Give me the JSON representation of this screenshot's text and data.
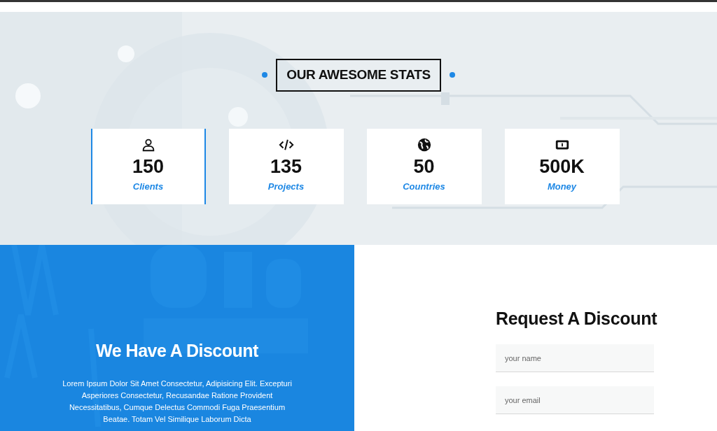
{
  "stats_section": {
    "title": "OUR AWESOME STATS",
    "stats": [
      {
        "kind": "user",
        "value": "150",
        "label": "Clients",
        "selected": true
      },
      {
        "kind": "code",
        "value": "135",
        "label": "Projects",
        "selected": false
      },
      {
        "kind": "globe",
        "value": "50",
        "label": "Countries",
        "selected": false
      },
      {
        "kind": "money",
        "value": "500K",
        "label": "Money",
        "selected": false
      }
    ]
  },
  "discount_section": {
    "title": "We Have A Discount",
    "text": "Lorem Ipsum Dolor Sit Amet Consectetur, Adipisicing Elit. Excepturi Asperiores Consectetur, Recusandae Ratione Provident Necessitatibus, Cumque Delectus Commodi Fuga Praesentium Beatae. Totam Vel Similique Laborum Dicta"
  },
  "request_form": {
    "title": "Request A Discount",
    "fields": [
      {
        "placeholder": "your name"
      },
      {
        "placeholder": "your email"
      }
    ]
  }
}
